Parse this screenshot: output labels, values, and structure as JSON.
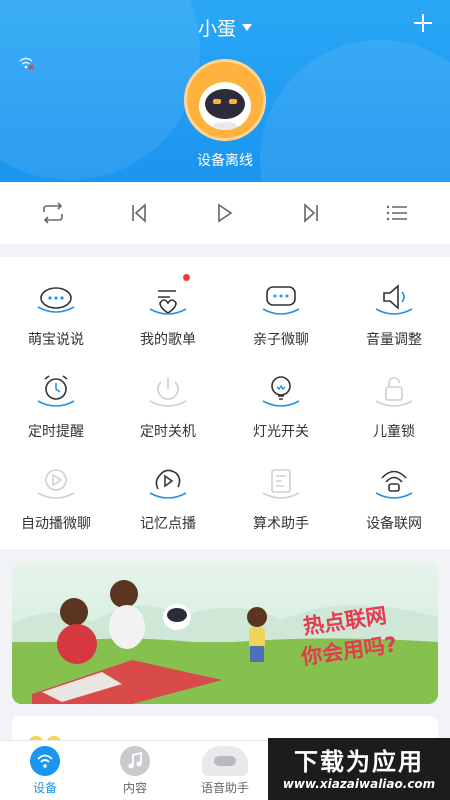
{
  "header": {
    "device_name": "小蛋",
    "status": "设备离线",
    "accent_color": "#1b95ee",
    "icons": [
      "wifi-off-icon",
      "plus-icon",
      "chevron-down-icon"
    ]
  },
  "player": {
    "controls": [
      "repeat-icon",
      "previous-icon",
      "play-icon",
      "next-icon",
      "playlist-icon"
    ]
  },
  "features": [
    {
      "label": "萌宝说说",
      "icon": "chat-bubble-icon"
    },
    {
      "label": "我的歌单",
      "icon": "playlist-heart-icon",
      "badge": true
    },
    {
      "label": "亲子微聊",
      "icon": "message-icon"
    },
    {
      "label": "音量调整",
      "icon": "volume-icon"
    },
    {
      "label": "定时提醒",
      "icon": "alarm-clock-icon"
    },
    {
      "label": "定时关机",
      "icon": "power-icon"
    },
    {
      "label": "灯光开关",
      "icon": "light-bulb-icon"
    },
    {
      "label": "儿童锁",
      "icon": "lock-icon"
    },
    {
      "label": "自动播微聊",
      "icon": "auto-play-icon"
    },
    {
      "label": "记忆点播",
      "icon": "memory-play-icon"
    },
    {
      "label": "算术助手",
      "icon": "math-icon"
    },
    {
      "label": "设备联网",
      "icon": "network-icon"
    }
  ],
  "banner": {
    "line1": "热点联网",
    "line2": "你会用吗?"
  },
  "tabs": [
    {
      "label": "设备",
      "active": true,
      "color": "#1b95ee"
    },
    {
      "label": "内容",
      "active": false,
      "color": "#666666"
    },
    {
      "label": "语音助手",
      "active": false,
      "color": "#666666"
    }
  ],
  "watermark": {
    "title": "下载为应用",
    "url": "www.xiazaiwaliao.com"
  }
}
